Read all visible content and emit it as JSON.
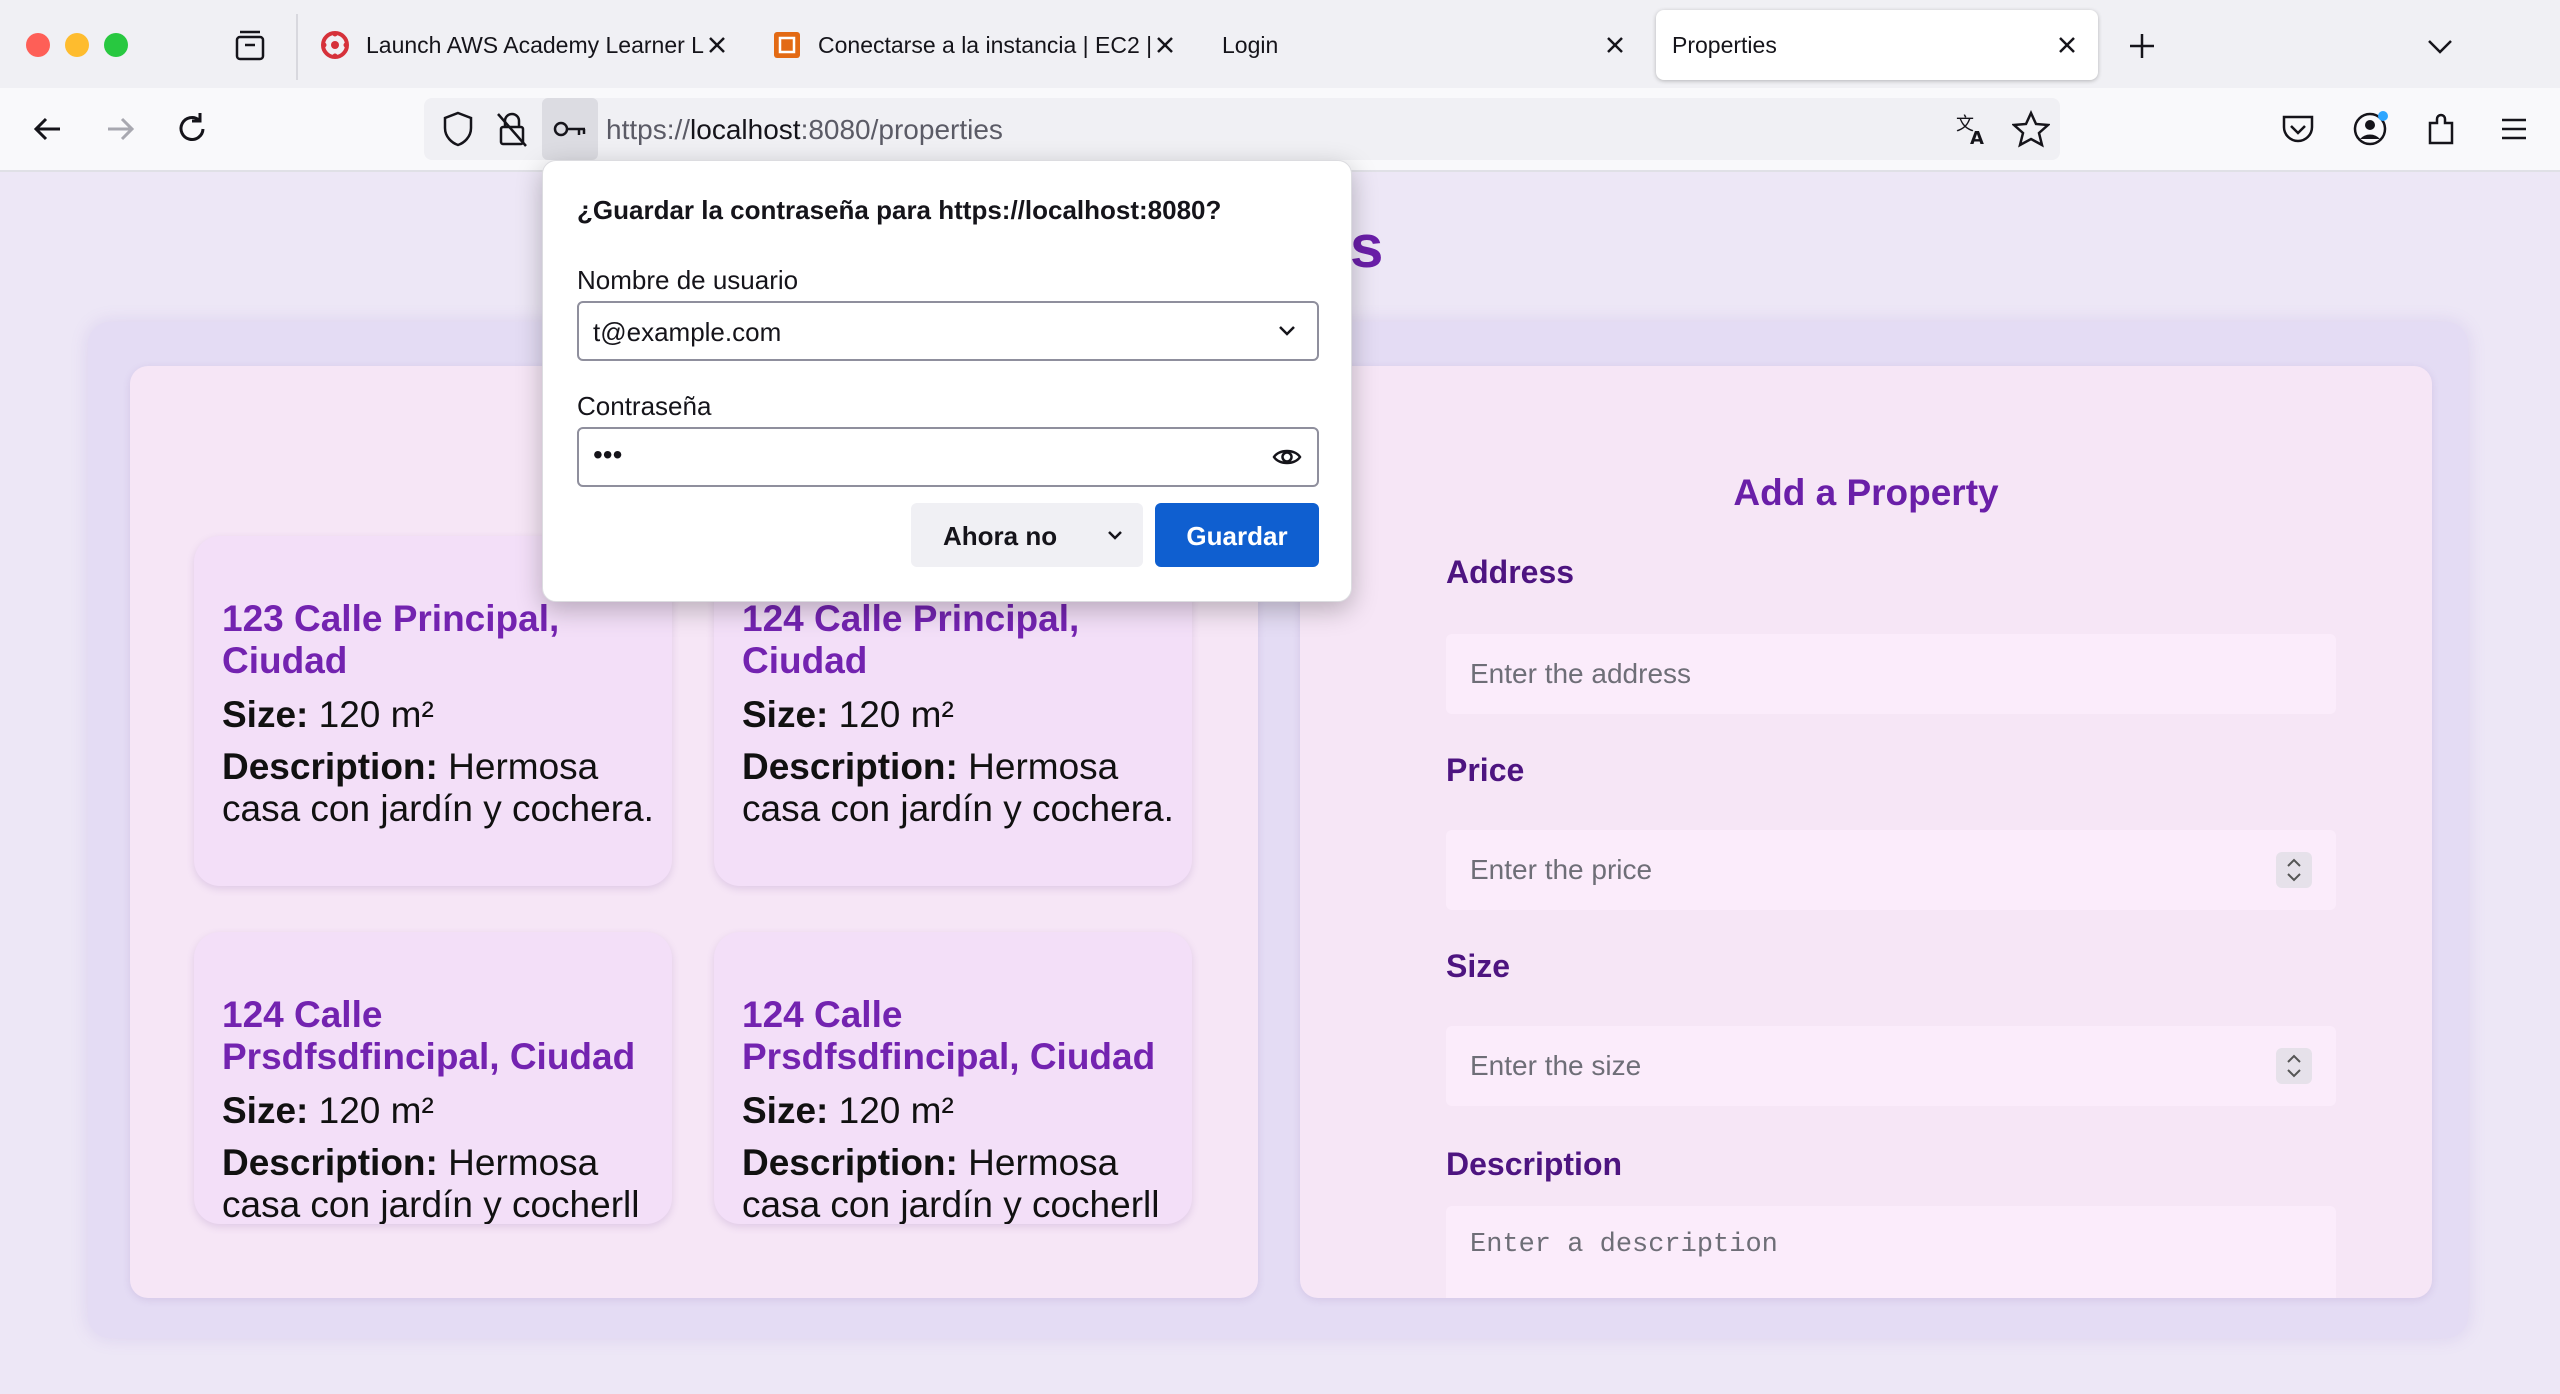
{
  "browser": {
    "tabs": [
      {
        "title": "Launch AWS Academy Learner L",
        "active": false
      },
      {
        "title": "Conectarse a la instancia | EC2 |",
        "active": false
      },
      {
        "title": "Login",
        "active": false
      },
      {
        "title": "Properties",
        "active": true
      }
    ],
    "url_scheme": "https://",
    "url_host": "localhost",
    "url_rest": ":8080/properties"
  },
  "page": {
    "title": "ies",
    "properties": [
      {
        "address": "123 Calle Principal, Ciudad",
        "size_label": "Size:",
        "size": "120 m²",
        "description_label": "Description:",
        "description": "Hermosa casa con jardín y cochera."
      },
      {
        "address": "124 Calle Principal, Ciudad",
        "size_label": "Size:",
        "size": "120 m²",
        "description_label": "Description:",
        "description": "Hermosa casa con jardín y cochera."
      },
      {
        "address": "124 Calle Prsdfsdfincipal, Ciudad",
        "size_label": "Size:",
        "size": "120 m²",
        "description_label": "Description:",
        "description": "Hermosa casa con jardín y cocherll ''la ''ldal dlad'' faldfald"
      },
      {
        "address": "124 Calle Prsdfsdfincipal, Ciudad",
        "size_label": "Size:",
        "size": "120 m²",
        "description_label": "Description:",
        "description": "Hermosa casa con jardín y cocherll ''la ''ldal dlad'' faldfald"
      }
    ],
    "form": {
      "title": "Add a Property",
      "address_label": "Address",
      "address_placeholder": "Enter the address",
      "price_label": "Price",
      "price_placeholder": "Enter the price",
      "size_label": "Size",
      "size_placeholder": "Enter the size",
      "description_label": "Description",
      "description_placeholder": "Enter a description"
    }
  },
  "password_prompt": {
    "title": "¿Guardar la contraseña para https://localhost:8080?",
    "username_label": "Nombre de usuario",
    "username_value": "t@example.com",
    "password_label": "Contraseña",
    "password_value": "•••",
    "not_now_label": "Ahora no",
    "save_label": "Guardar"
  },
  "colors": {
    "accent": "#6a1fa8",
    "save_button": "#0f5fd0"
  }
}
